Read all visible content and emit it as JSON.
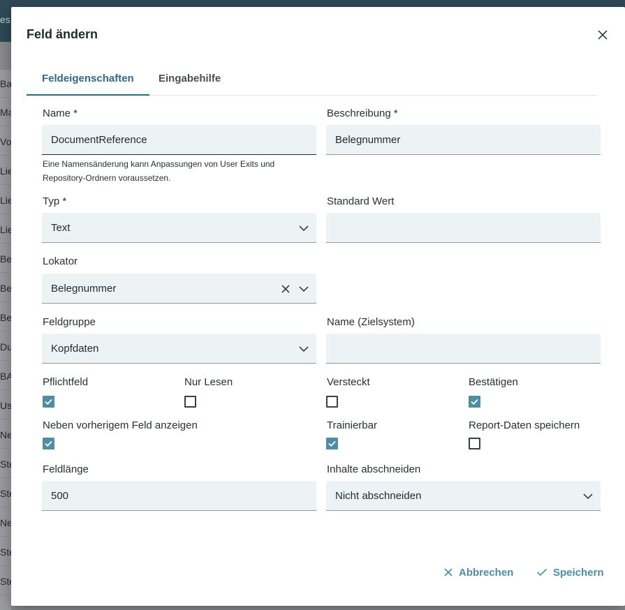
{
  "background": {
    "header_fragment": "es",
    "rows": [
      "Bar",
      "Mar",
      "Vor",
      "Lief",
      "Lief",
      "Lief",
      "Bel",
      "Bel",
      "Bes",
      "Dub",
      "BA",
      "Ust",
      "Net",
      "Ste",
      "Ste",
      "Net",
      "Ste",
      "Ste"
    ]
  },
  "dialog": {
    "title": "Feld ändern",
    "tabs": [
      {
        "label": "Feldeigenschaften",
        "active": true
      },
      {
        "label": "Eingabehilfe",
        "active": false
      }
    ]
  },
  "form": {
    "name": {
      "label": "Name *",
      "value": "DocumentReference",
      "hint": "Eine Namensänderung kann Anpassungen von User Exits und Repository-Ordnern voraussetzen."
    },
    "beschreibung": {
      "label": "Beschreibung *",
      "value": "Belegnummer"
    },
    "typ": {
      "label": "Typ *",
      "value": "Text"
    },
    "standard_wert": {
      "label": "Standard Wert",
      "value": ""
    },
    "lokator": {
      "label": "Lokator",
      "value": "Belegnummer"
    },
    "feldgruppe": {
      "label": "Feldgruppe",
      "value": "Kopfdaten"
    },
    "name_zielsystem": {
      "label": "Name (Zielsystem)",
      "value": ""
    },
    "checkboxes": [
      {
        "label": "Pflichtfeld",
        "checked": true
      },
      {
        "label": "Nur Lesen",
        "checked": false
      },
      {
        "label": "Versteckt",
        "checked": false
      },
      {
        "label": "Bestätigen",
        "checked": true
      },
      {
        "label": "Neben vorherigem Feld anzeigen",
        "checked": true
      },
      {
        "label": "Trainierbar",
        "checked": true
      },
      {
        "label": "Report-Daten speichern",
        "checked": false
      }
    ],
    "feldlaenge": {
      "label": "Feldlänge",
      "value": "500"
    },
    "inhalte_abschneiden": {
      "label": "Inhalte abschneiden",
      "value": "Nicht abschneiden"
    }
  },
  "actions": {
    "cancel": "Abbrechen",
    "save": "Speichern"
  },
  "colors": {
    "accent": "#4e8da3",
    "tab_active": "#2f6a82",
    "field_bg": "#edf2f4"
  }
}
